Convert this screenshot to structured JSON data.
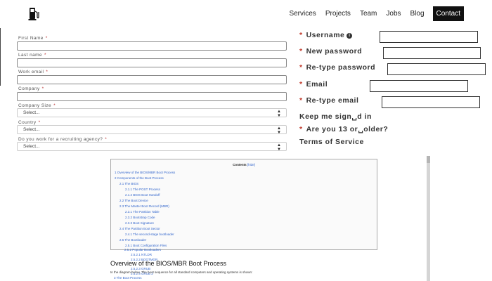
{
  "navbar": {
    "logo_icon": "fuel-pump-icon",
    "links": [
      "Services",
      "Projects",
      "Team",
      "Jobs",
      "Blog"
    ],
    "contact": "Contact",
    "contact_bg": "#111111"
  },
  "signup_form": {
    "required_mark": "*",
    "first_name": "First Name",
    "last_name": "Last name",
    "work_email": "Work email",
    "company": "Company",
    "company_size": {
      "label": "Company Size",
      "selected": "Select..."
    },
    "country": {
      "label": "Country",
      "selected": "Select..."
    },
    "recruiting_agency": {
      "label": "Do you work for a recruiting agency?",
      "selected": "Select..."
    }
  },
  "account_form": {
    "required_mark": "*",
    "star_color": "#c0392b",
    "username": "Username",
    "info_icon": "info-icon",
    "new_password": "New password",
    "retype_password": "Re-type password",
    "email": "Email",
    "retype_email": "Re-type email",
    "keep_signed_in": "Keep me sign␣d in",
    "age_check": "Are you 13 or␣older?",
    "terms": "Terms of Service"
  },
  "wiki": {
    "contents_title": "Contents",
    "hide_link": "[hide]",
    "toc": [
      "1 Overview of the BIOS/MBR Boot Process",
      "2 Components of the Boot Process",
      "2.1 The BIOS",
      "2.1.1 The POST Process",
      "2.1.2 BIOS Boot Handoff",
      "2.2 The Boot Device",
      "2.3 The Master Boot Record (MBR)",
      "2.3.1 The Partition Table",
      "2.3.2 Bootstrap Code",
      "2.3.3 Boot Signature",
      "2.4 The Partition Boot Sector",
      "2.4.1 The second-stage bootloader",
      "2.5 The Bootloader",
      "2.5.1 Boot Configuration Files",
      "2.5.2 Popular Bootloaders",
      "2.5.2.1 NTLDR",
      "2.5.2.2 BOOTMGR",
      "2.5.2.3 GRUB",
      "2.5.2.4 GRUB 2"
    ],
    "toc_tail": "3 The Boot Process",
    "heading": "Overview of the BIOS/MBR Boot Process",
    "intro": "In the diagram below, The boot sequence for all standard computers and operating systems is shown:"
  }
}
